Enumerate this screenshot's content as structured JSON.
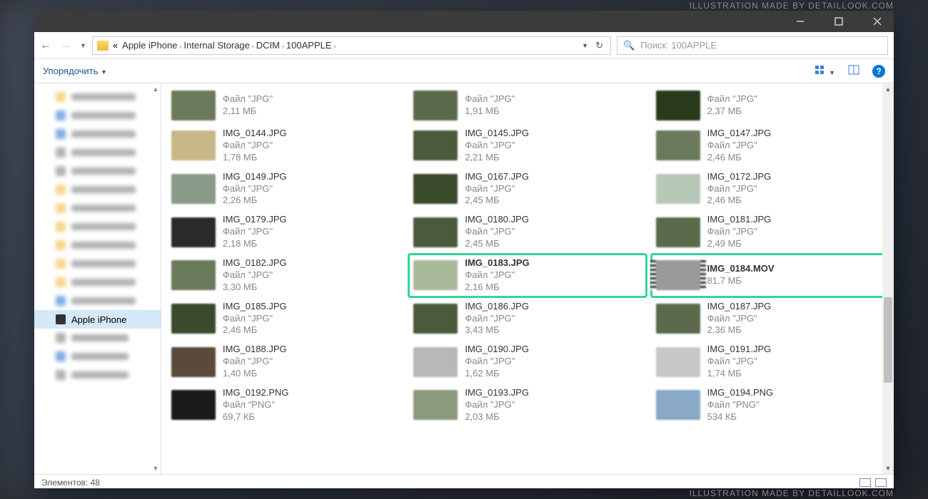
{
  "watermark_top": "ILLUSTRATION MADE BY DETAILLOOK.COM",
  "watermark_bottom": "ILLUSTRATION MADE BY DETAILLOOK.COM",
  "breadcrumbs": [
    "Apple iPhone",
    "Internal Storage",
    "DCIM",
    "100APPLE"
  ],
  "search_placeholder": "Поиск: 100APPLE",
  "organize_label": "Упорядочить",
  "sidebar": {
    "active_label": "Apple iPhone",
    "blurred_items": [
      {
        "color": "#f0c14b"
      },
      {
        "color": "#3b82d8"
      },
      {
        "color": "#3b82d8"
      },
      {
        "color": "#888"
      },
      {
        "color": "#888"
      },
      {
        "color": "#f0c14b"
      },
      {
        "color": "#f0c14b"
      },
      {
        "color": "#f0c14b"
      },
      {
        "color": "#f0c14b"
      },
      {
        "color": "#f0c14b"
      },
      {
        "color": "#f0c14b"
      },
      {
        "color": "#3b82d8"
      }
    ],
    "after_active": [
      {
        "color": "#888"
      },
      {
        "color": "#3b82d8"
      },
      {
        "color": "#888"
      }
    ]
  },
  "files": [
    {
      "name": "",
      "type": "Файл \"JPG\"",
      "size": "2,11 МБ",
      "thumb": "#6a7a5a"
    },
    {
      "name": "",
      "type": "Файл \"JPG\"",
      "size": "1,91 МБ",
      "thumb": "#5a6a4a"
    },
    {
      "name": "",
      "type": "Файл \"JPG\"",
      "size": "2,37 МБ",
      "thumb": "#2a3a1a"
    },
    {
      "name": "IMG_0144.JPG",
      "type": "Файл \"JPG\"",
      "size": "1,78 МБ",
      "thumb": "#c8b888"
    },
    {
      "name": "IMG_0145.JPG",
      "type": "Файл \"JPG\"",
      "size": "2,21 МБ",
      "thumb": "#4a5a3a"
    },
    {
      "name": "IMG_0147.JPG",
      "type": "Файл \"JPG\"",
      "size": "2,46 МБ",
      "thumb": "#6a7a5a"
    },
    {
      "name": "IMG_0149.JPG",
      "type": "Файл \"JPG\"",
      "size": "2,26 МБ",
      "thumb": "#8a9a8a"
    },
    {
      "name": "IMG_0167.JPG",
      "type": "Файл \"JPG\"",
      "size": "2,45 МБ",
      "thumb": "#3a4a2a"
    },
    {
      "name": "IMG_0172.JPG",
      "type": "Файл \"JPG\"",
      "size": "2,46 МБ",
      "thumb": "#b8c8b8"
    },
    {
      "name": "IMG_0179.JPG",
      "type": "Файл \"JPG\"",
      "size": "2,18 МБ",
      "thumb": "#2a2a2a"
    },
    {
      "name": "IMG_0180.JPG",
      "type": "Файл \"JPG\"",
      "size": "2,45 МБ",
      "thumb": "#4a5a3a"
    },
    {
      "name": "IMG_0181.JPG",
      "type": "Файл \"JPG\"",
      "size": "2,49 МБ",
      "thumb": "#5a6a4a"
    },
    {
      "name": "IMG_0182.JPG",
      "type": "Файл \"JPG\"",
      "size": "3,30 МБ",
      "thumb": "#6a7a5a"
    },
    {
      "name": "IMG_0183.JPG",
      "type": "Файл \"JPG\"",
      "size": "2,16 МБ",
      "thumb": "#a8b898",
      "highlight": true
    },
    {
      "name": "IMG_0184.MOV",
      "type": "",
      "size": "81,7 МБ",
      "thumb": "#999",
      "highlight": true,
      "video": true
    },
    {
      "name": "IMG_0185.JPG",
      "type": "Файл \"JPG\"",
      "size": "2,46 МБ",
      "thumb": "#3a4a2a"
    },
    {
      "name": "IMG_0186.JPG",
      "type": "Файл \"JPG\"",
      "size": "3,43 МБ",
      "thumb": "#4a5a3a"
    },
    {
      "name": "IMG_0187.JPG",
      "type": "Файл \"JPG\"",
      "size": "2,36 МБ",
      "thumb": "#5a6a4a"
    },
    {
      "name": "IMG_0188.JPG",
      "type": "Файл \"JPG\"",
      "size": "1,40 МБ",
      "thumb": "#5a4a3a"
    },
    {
      "name": "IMG_0190.JPG",
      "type": "Файл \"JPG\"",
      "size": "1,62 МБ",
      "thumb": "#b8b8b8"
    },
    {
      "name": "IMG_0191.JPG",
      "type": "Файл \"JPG\"",
      "size": "1,74 МБ",
      "thumb": "#c8c8c8"
    },
    {
      "name": "IMG_0192.PNG",
      "type": "Файл \"PNG\"",
      "size": "69,7 КБ",
      "thumb": "#1a1a1a"
    },
    {
      "name": "IMG_0193.JPG",
      "type": "Файл \"JPG\"",
      "size": "2,03 МБ",
      "thumb": "#8a9a7a"
    },
    {
      "name": "IMG_0194.PNG",
      "type": "Файл \"PNG\"",
      "size": "534 КБ",
      "thumb": "#8aa8c8"
    }
  ],
  "status": {
    "count_label": "Элементов: 48"
  }
}
